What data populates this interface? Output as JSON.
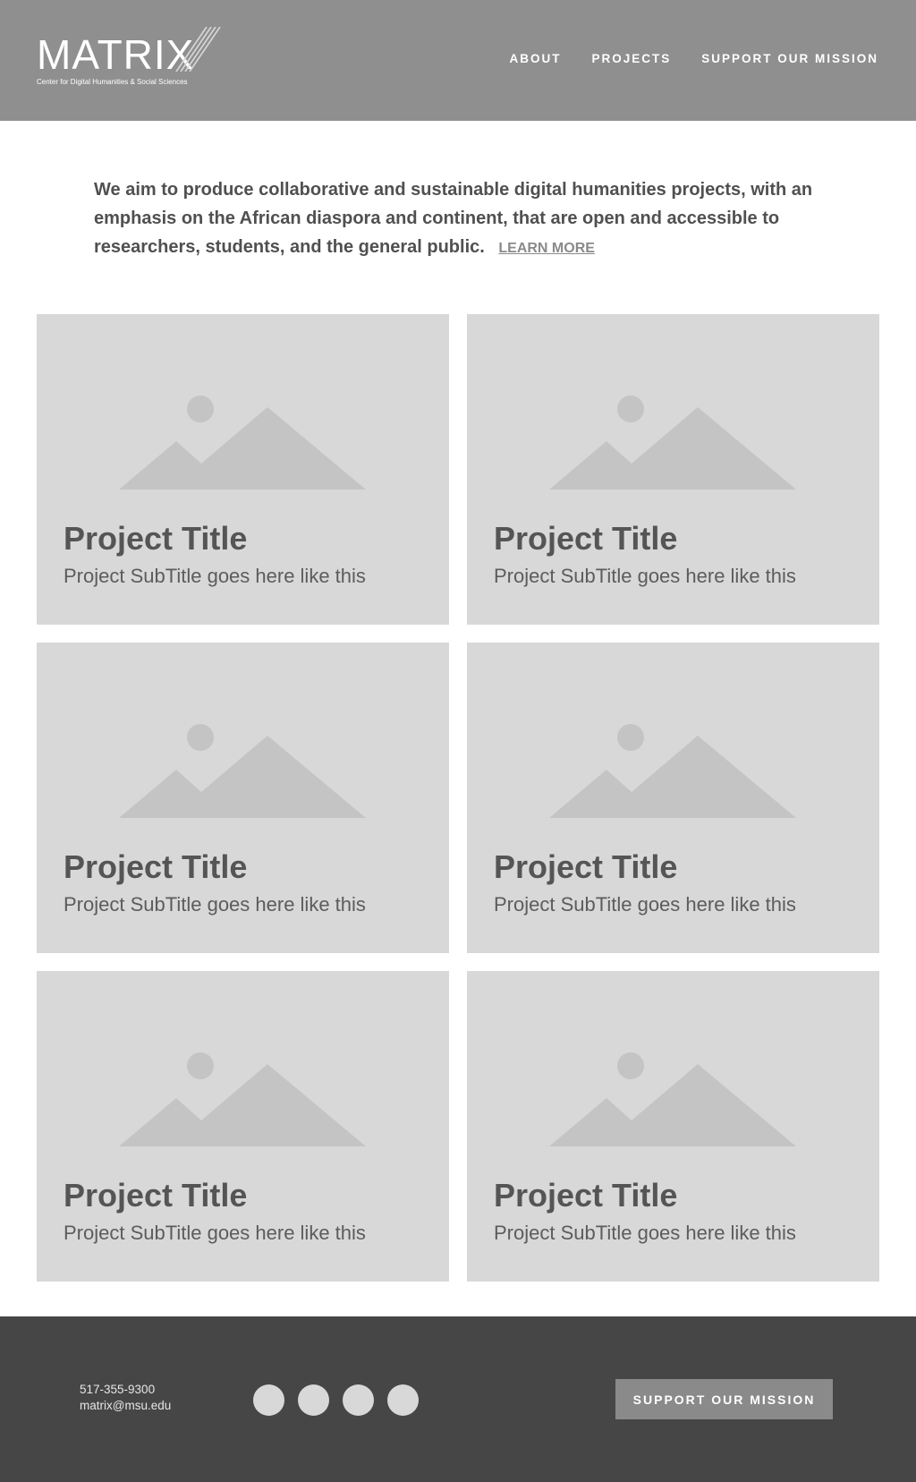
{
  "header": {
    "logo_text": "MATRIX",
    "logo_tagline": "Center for Digital Humanities & Social Sciences",
    "nav": [
      {
        "label": "ABOUT"
      },
      {
        "label": "PROJECTS"
      },
      {
        "label": "SUPPORT OUR MISSION"
      }
    ]
  },
  "intro": {
    "text": "We aim to produce collaborative and sustainable digital humanities projects, with an emphasis on the African diaspora and continent, that are open and accessible to researchers, students, and the general public.",
    "link_label": "LEARN MORE"
  },
  "projects": [
    {
      "title": "Project Title",
      "subtitle": "Project SubTitle goes here like this"
    },
    {
      "title": "Project Title",
      "subtitle": "Project SubTitle goes here like this"
    },
    {
      "title": "Project Title",
      "subtitle": "Project SubTitle goes here like this"
    },
    {
      "title": "Project Title",
      "subtitle": "Project SubTitle goes here like this"
    },
    {
      "title": "Project Title",
      "subtitle": "Project SubTitle goes here like this"
    },
    {
      "title": "Project Title",
      "subtitle": "Project SubTitle goes here like this"
    }
  ],
  "footer": {
    "phone": "517-355-9300",
    "email": "matrix@msu.edu",
    "social_icons": [
      "social-icon",
      "social-icon",
      "social-icon",
      "social-icon"
    ],
    "support_label": "SUPPORT OUR MISSION"
  },
  "colors": {
    "header_bg": "#8f8f8f",
    "card_bg": "#d8d8d8",
    "placeholder_shape": "#c4c4c4",
    "footer_bg": "#464646",
    "button_bg": "#8a8a8a"
  }
}
